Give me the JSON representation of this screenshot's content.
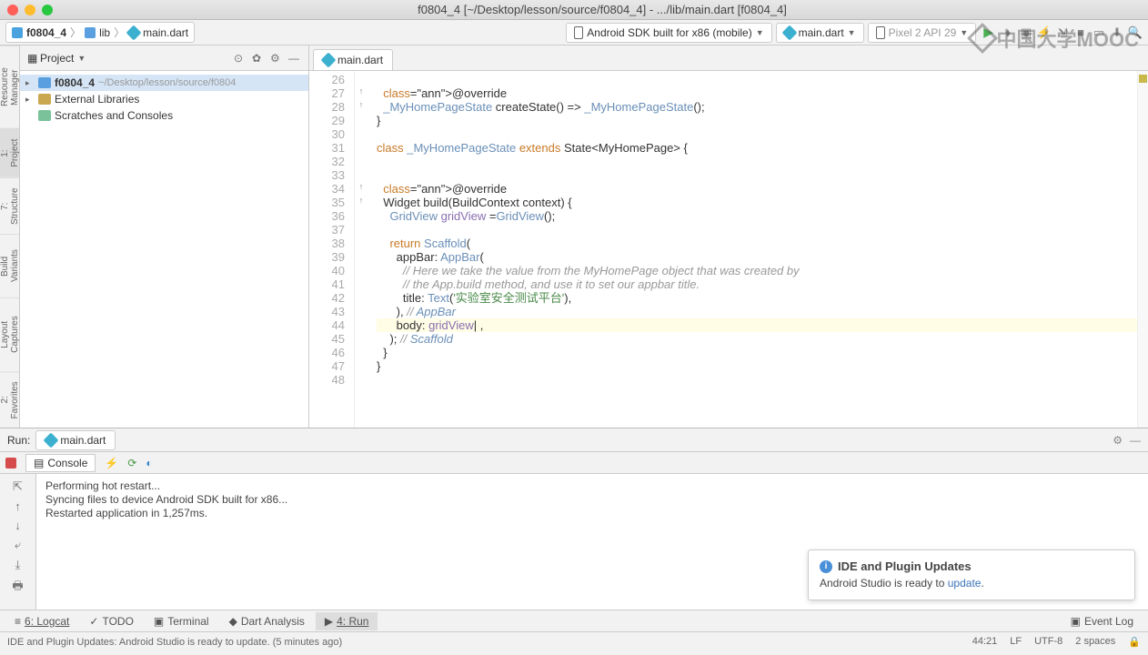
{
  "window": {
    "title": "f0804_4 [~/Desktop/lesson/source/f0804_4] - .../lib/main.dart [f0804_4]"
  },
  "breadcrumb": {
    "project": "f0804_4",
    "folder": "lib",
    "file": "main.dart"
  },
  "toolbar": {
    "device": "Android SDK built for x86 (mobile)",
    "runconfig": "main.dart",
    "emulator": "Pixel 2 API 29"
  },
  "watermark": "中国大学MOOC",
  "left_rails": [
    "Resource Manager",
    "1: Project",
    "7: Structure",
    "Build Variants",
    "Layout Captures",
    "2: Favorites"
  ],
  "project": {
    "label": "Project",
    "tree": [
      {
        "name": "f0804_4",
        "path": "~/Desktop/lesson/source/f0804",
        "icon": "fldr",
        "sel": true,
        "tri": "▸"
      },
      {
        "name": "External Libraries",
        "icon": "lib",
        "tri": "▸"
      },
      {
        "name": "Scratches and Consoles",
        "icon": "scratch",
        "tri": ""
      }
    ]
  },
  "editor": {
    "tab": "main.dart",
    "first_line": 26,
    "lines": [
      "",
      "  @override",
      "  _MyHomePageState createState() => _MyHomePageState();",
      "}",
      "",
      "class _MyHomePageState extends State<MyHomePage> {",
      "",
      "",
      "  @override",
      "  Widget build(BuildContext context) {",
      "    GridView gridView =GridView();",
      "",
      "    return Scaffold(",
      "      appBar: AppBar(",
      "        // Here we take the value from the MyHomePage object that was created by",
      "        // the App.build method, and use it to set our appbar title.",
      "        title: Text('实验室安全测试平台'),",
      "      ), // AppBar",
      "      body: gridView| ,",
      "    ); // Scaffold",
      "  }",
      "}",
      ""
    ],
    "highlight_index": 18
  },
  "run": {
    "label": "Run:",
    "tab": "main.dart",
    "console_label": "Console",
    "output": [
      "Performing hot restart...",
      "Syncing files to device Android SDK built for x86...",
      "Restarted application in 1,257ms."
    ]
  },
  "notify": {
    "title": "IDE and Plugin Updates",
    "body_prefix": "Android Studio is ready to ",
    "link": "update",
    "body_suffix": "."
  },
  "bottom_tabs": {
    "logcat": "6: Logcat",
    "todo": "TODO",
    "terminal": "Terminal",
    "dart": "Dart Analysis",
    "run": "4: Run",
    "eventlog": "Event Log"
  },
  "status": {
    "msg": "IDE and Plugin Updates: Android Studio is ready to update. (5 minutes ago)",
    "pos": "44:21",
    "le": "LF",
    "enc": "UTF-8",
    "indent": "2 spaces"
  }
}
